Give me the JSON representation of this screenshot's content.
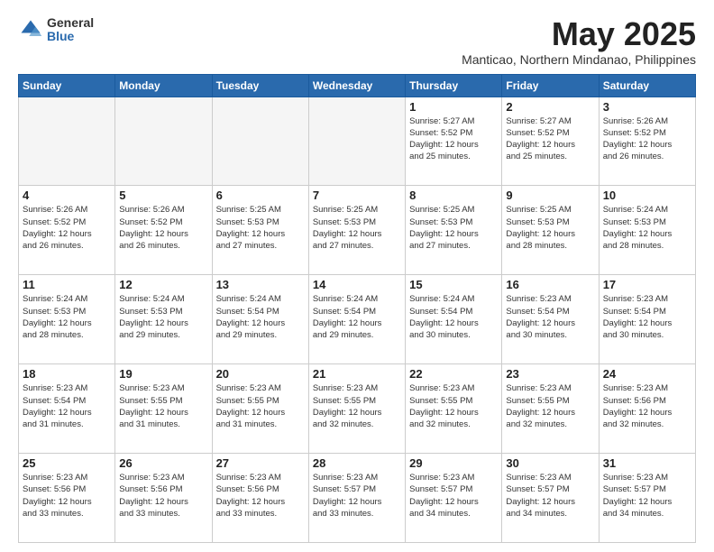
{
  "logo": {
    "general": "General",
    "blue": "Blue"
  },
  "header": {
    "month": "May 2025",
    "location": "Manticao, Northern Mindanao, Philippines"
  },
  "weekdays": [
    "Sunday",
    "Monday",
    "Tuesday",
    "Wednesday",
    "Thursday",
    "Friday",
    "Saturday"
  ],
  "weeks": [
    [
      {
        "day": "",
        "info": ""
      },
      {
        "day": "",
        "info": ""
      },
      {
        "day": "",
        "info": ""
      },
      {
        "day": "",
        "info": ""
      },
      {
        "day": "1",
        "info": "Sunrise: 5:27 AM\nSunset: 5:52 PM\nDaylight: 12 hours\nand 25 minutes."
      },
      {
        "day": "2",
        "info": "Sunrise: 5:27 AM\nSunset: 5:52 PM\nDaylight: 12 hours\nand 25 minutes."
      },
      {
        "day": "3",
        "info": "Sunrise: 5:26 AM\nSunset: 5:52 PM\nDaylight: 12 hours\nand 26 minutes."
      }
    ],
    [
      {
        "day": "4",
        "info": "Sunrise: 5:26 AM\nSunset: 5:52 PM\nDaylight: 12 hours\nand 26 minutes."
      },
      {
        "day": "5",
        "info": "Sunrise: 5:26 AM\nSunset: 5:52 PM\nDaylight: 12 hours\nand 26 minutes."
      },
      {
        "day": "6",
        "info": "Sunrise: 5:25 AM\nSunset: 5:53 PM\nDaylight: 12 hours\nand 27 minutes."
      },
      {
        "day": "7",
        "info": "Sunrise: 5:25 AM\nSunset: 5:53 PM\nDaylight: 12 hours\nand 27 minutes."
      },
      {
        "day": "8",
        "info": "Sunrise: 5:25 AM\nSunset: 5:53 PM\nDaylight: 12 hours\nand 27 minutes."
      },
      {
        "day": "9",
        "info": "Sunrise: 5:25 AM\nSunset: 5:53 PM\nDaylight: 12 hours\nand 28 minutes."
      },
      {
        "day": "10",
        "info": "Sunrise: 5:24 AM\nSunset: 5:53 PM\nDaylight: 12 hours\nand 28 minutes."
      }
    ],
    [
      {
        "day": "11",
        "info": "Sunrise: 5:24 AM\nSunset: 5:53 PM\nDaylight: 12 hours\nand 28 minutes."
      },
      {
        "day": "12",
        "info": "Sunrise: 5:24 AM\nSunset: 5:53 PM\nDaylight: 12 hours\nand 29 minutes."
      },
      {
        "day": "13",
        "info": "Sunrise: 5:24 AM\nSunset: 5:54 PM\nDaylight: 12 hours\nand 29 minutes."
      },
      {
        "day": "14",
        "info": "Sunrise: 5:24 AM\nSunset: 5:54 PM\nDaylight: 12 hours\nand 29 minutes."
      },
      {
        "day": "15",
        "info": "Sunrise: 5:24 AM\nSunset: 5:54 PM\nDaylight: 12 hours\nand 30 minutes."
      },
      {
        "day": "16",
        "info": "Sunrise: 5:23 AM\nSunset: 5:54 PM\nDaylight: 12 hours\nand 30 minutes."
      },
      {
        "day": "17",
        "info": "Sunrise: 5:23 AM\nSunset: 5:54 PM\nDaylight: 12 hours\nand 30 minutes."
      }
    ],
    [
      {
        "day": "18",
        "info": "Sunrise: 5:23 AM\nSunset: 5:54 PM\nDaylight: 12 hours\nand 31 minutes."
      },
      {
        "day": "19",
        "info": "Sunrise: 5:23 AM\nSunset: 5:55 PM\nDaylight: 12 hours\nand 31 minutes."
      },
      {
        "day": "20",
        "info": "Sunrise: 5:23 AM\nSunset: 5:55 PM\nDaylight: 12 hours\nand 31 minutes."
      },
      {
        "day": "21",
        "info": "Sunrise: 5:23 AM\nSunset: 5:55 PM\nDaylight: 12 hours\nand 32 minutes."
      },
      {
        "day": "22",
        "info": "Sunrise: 5:23 AM\nSunset: 5:55 PM\nDaylight: 12 hours\nand 32 minutes."
      },
      {
        "day": "23",
        "info": "Sunrise: 5:23 AM\nSunset: 5:55 PM\nDaylight: 12 hours\nand 32 minutes."
      },
      {
        "day": "24",
        "info": "Sunrise: 5:23 AM\nSunset: 5:56 PM\nDaylight: 12 hours\nand 32 minutes."
      }
    ],
    [
      {
        "day": "25",
        "info": "Sunrise: 5:23 AM\nSunset: 5:56 PM\nDaylight: 12 hours\nand 33 minutes."
      },
      {
        "day": "26",
        "info": "Sunrise: 5:23 AM\nSunset: 5:56 PM\nDaylight: 12 hours\nand 33 minutes."
      },
      {
        "day": "27",
        "info": "Sunrise: 5:23 AM\nSunset: 5:56 PM\nDaylight: 12 hours\nand 33 minutes."
      },
      {
        "day": "28",
        "info": "Sunrise: 5:23 AM\nSunset: 5:57 PM\nDaylight: 12 hours\nand 33 minutes."
      },
      {
        "day": "29",
        "info": "Sunrise: 5:23 AM\nSunset: 5:57 PM\nDaylight: 12 hours\nand 34 minutes."
      },
      {
        "day": "30",
        "info": "Sunrise: 5:23 AM\nSunset: 5:57 PM\nDaylight: 12 hours\nand 34 minutes."
      },
      {
        "day": "31",
        "info": "Sunrise: 5:23 AM\nSunset: 5:57 PM\nDaylight: 12 hours\nand 34 minutes."
      }
    ]
  ]
}
